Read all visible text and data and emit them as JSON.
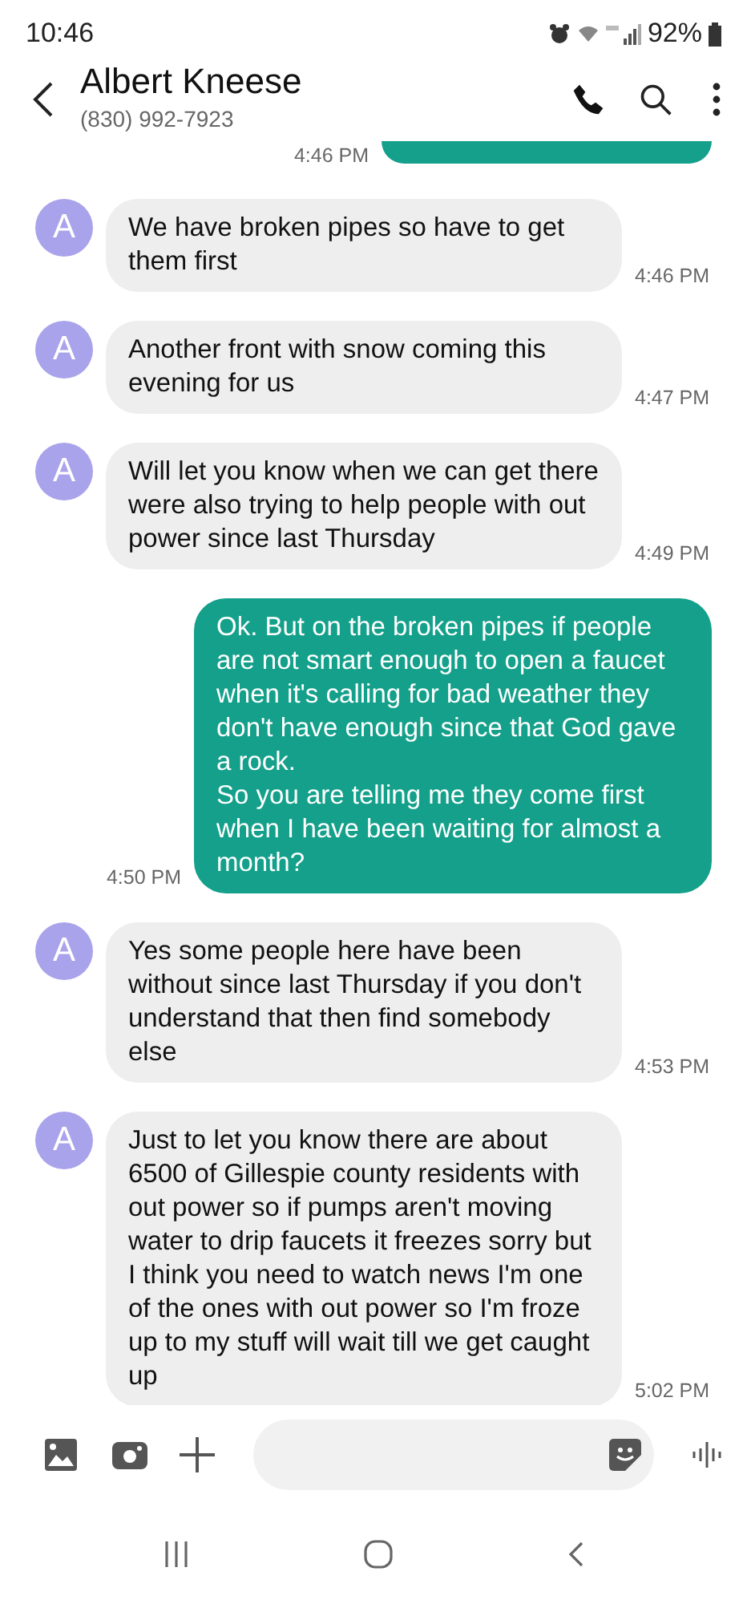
{
  "status_bar": {
    "time": "10:46",
    "battery": "92%"
  },
  "header": {
    "name": "Albert Kneese",
    "phone": "(830) 992-7923"
  },
  "cut_message": {
    "time": "4:46 PM",
    "kind": "sent"
  },
  "messages": [
    {
      "kind": "received",
      "avatar": "A",
      "text": "We have broken pipes so have to get them first",
      "time": "4:46 PM"
    },
    {
      "kind": "received",
      "avatar": "A",
      "text": "Another front with snow coming this evening for us",
      "time": "4:47 PM"
    },
    {
      "kind": "received",
      "avatar": "A",
      "text": "Will let you know when we can get there were also trying to help people with out power since last Thursday",
      "time": "4:49 PM"
    },
    {
      "kind": "sent",
      "text": "Ok. But on the broken pipes if people are not smart enough to open a faucet when it's calling for bad weather they don't have enough since that God gave a rock.\nSo you are telling me they come first when I have been waiting for almost a month?",
      "time": "4:50 PM"
    },
    {
      "kind": "received",
      "avatar": "A",
      "text": "Yes some people here have been without since last Thursday if you don't understand that then find somebody else",
      "time": "4:53 PM"
    },
    {
      "kind": "received",
      "avatar": "A",
      "text": "Just to let you know there are about 6500 of Gillespie county residents with out power so if pumps aren't moving water to drip faucets it freezes sorry but I think you need to watch news I'm one of the ones with out power so I'm froze up to my stuff will wait till we get caught up",
      "time": "5:02 PM"
    }
  ]
}
